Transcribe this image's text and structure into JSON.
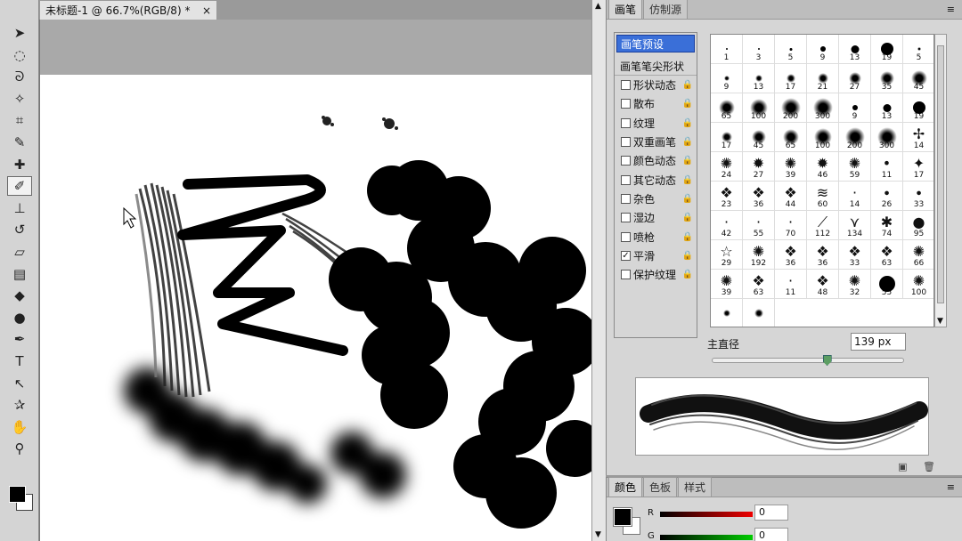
{
  "document": {
    "tab_title": "未标题-1 @ 66.7%(RGB/8) *",
    "close_glyph": "×"
  },
  "brush_panel": {
    "tabs": [
      "画笔",
      "仿制源"
    ],
    "presets_label": "画笔预设",
    "tip_shape_label": "画笔笔尖形状",
    "options": [
      {
        "label": "形状动态",
        "checked": false
      },
      {
        "label": "散布",
        "checked": false
      },
      {
        "label": "纹理",
        "checked": false
      },
      {
        "label": "双重画笔",
        "checked": false
      },
      {
        "label": "颜色动态",
        "checked": false
      },
      {
        "label": "其它动态",
        "checked": false
      },
      {
        "label": "杂色",
        "checked": false
      },
      {
        "label": "湿边",
        "checked": false
      },
      {
        "label": "喷枪",
        "checked": false
      },
      {
        "label": "平滑",
        "checked": true
      },
      {
        "label": "保护纹理",
        "checked": false
      }
    ],
    "brush_tips": [
      {
        "size": "1",
        "kind": "hard",
        "d": 2
      },
      {
        "size": "3",
        "kind": "hard",
        "d": 2
      },
      {
        "size": "5",
        "kind": "hard",
        "d": 3
      },
      {
        "size": "9",
        "kind": "hard",
        "d": 6
      },
      {
        "size": "13",
        "kind": "hard",
        "d": 9
      },
      {
        "size": "19",
        "kind": "hard",
        "d": 14
      },
      {
        "size": "5",
        "kind": "soft",
        "d": 4
      },
      {
        "size": "9",
        "kind": "soft",
        "d": 6
      },
      {
        "size": "13",
        "kind": "soft",
        "d": 8
      },
      {
        "size": "17",
        "kind": "soft",
        "d": 10
      },
      {
        "size": "21",
        "kind": "soft",
        "d": 12
      },
      {
        "size": "27",
        "kind": "soft",
        "d": 14
      },
      {
        "size": "35",
        "kind": "soft",
        "d": 16
      },
      {
        "size": "45",
        "kind": "soft",
        "d": 18
      },
      {
        "size": "65",
        "kind": "soft",
        "d": 18
      },
      {
        "size": "100",
        "kind": "soft",
        "d": 20
      },
      {
        "size": "200",
        "kind": "soft",
        "d": 22
      },
      {
        "size": "300",
        "kind": "soft",
        "d": 22
      },
      {
        "size": "9",
        "kind": "hard",
        "d": 6
      },
      {
        "size": "13",
        "kind": "hard",
        "d": 9
      },
      {
        "size": "19",
        "kind": "hard",
        "d": 14
      },
      {
        "size": "17",
        "kind": "soft",
        "d": 12
      },
      {
        "size": "45",
        "kind": "soft",
        "d": 16
      },
      {
        "size": "65",
        "kind": "soft",
        "d": 18
      },
      {
        "size": "100",
        "kind": "soft",
        "d": 20
      },
      {
        "size": "200",
        "kind": "soft",
        "d": 22
      },
      {
        "size": "300",
        "kind": "soft",
        "d": 22
      },
      {
        "size": "14",
        "kind": "shape",
        "g": "✢"
      },
      {
        "size": "24",
        "kind": "shape",
        "g": "✺"
      },
      {
        "size": "27",
        "kind": "shape",
        "g": "✹"
      },
      {
        "size": "39",
        "kind": "shape",
        "g": "✺"
      },
      {
        "size": "46",
        "kind": "shape",
        "g": "✹"
      },
      {
        "size": "59",
        "kind": "shape",
        "g": "✺"
      },
      {
        "size": "11",
        "kind": "shape",
        "g": "•"
      },
      {
        "size": "17",
        "kind": "shape",
        "g": "✦"
      },
      {
        "size": "23",
        "kind": "shape",
        "g": "❖"
      },
      {
        "size": "36",
        "kind": "shape",
        "g": "❖"
      },
      {
        "size": "44",
        "kind": "shape",
        "g": "❖"
      },
      {
        "size": "60",
        "kind": "shape",
        "g": "≋"
      },
      {
        "size": "14",
        "kind": "shape",
        "g": "·"
      },
      {
        "size": "26",
        "kind": "shape",
        "g": "∙"
      },
      {
        "size": "33",
        "kind": "shape",
        "g": "∙"
      },
      {
        "size": "42",
        "kind": "shape",
        "g": "·"
      },
      {
        "size": "55",
        "kind": "shape",
        "g": "·"
      },
      {
        "size": "70",
        "kind": "shape",
        "g": "·"
      },
      {
        "size": "112",
        "kind": "shape",
        "g": "⟋"
      },
      {
        "size": "134",
        "kind": "shape",
        "g": "⋎"
      },
      {
        "size": "74",
        "kind": "shape",
        "g": "✱"
      },
      {
        "size": "95",
        "kind": "shape",
        "g": "●"
      },
      {
        "size": "29",
        "kind": "shape",
        "g": "☆"
      },
      {
        "size": "192",
        "kind": "shape",
        "g": "✺"
      },
      {
        "size": "36",
        "kind": "shape",
        "g": "❖"
      },
      {
        "size": "36",
        "kind": "shape",
        "g": "❖"
      },
      {
        "size": "33",
        "kind": "shape",
        "g": "❖"
      },
      {
        "size": "63",
        "kind": "shape",
        "g": "❖"
      },
      {
        "size": "66",
        "kind": "shape",
        "g": "✺"
      },
      {
        "size": "39",
        "kind": "shape",
        "g": "✺"
      },
      {
        "size": "63",
        "kind": "shape",
        "g": "❖"
      },
      {
        "size": "11",
        "kind": "shape",
        "g": "·"
      },
      {
        "size": "48",
        "kind": "shape",
        "g": "❖"
      },
      {
        "size": "32",
        "kind": "shape",
        "g": "✺"
      },
      {
        "size": "55",
        "kind": "hard",
        "d": 18
      },
      {
        "size": "100",
        "kind": "shape",
        "g": "✺"
      },
      {
        "size": "",
        "kind": "soft",
        "d": 8
      },
      {
        "size": "",
        "kind": "soft",
        "d": 10
      }
    ],
    "diameter_label": "主直径",
    "diameter_value": "139 px",
    "diameter_level": 0.6
  },
  "color_panel": {
    "tabs": [
      "颜色",
      "色板",
      "样式"
    ],
    "channels": [
      {
        "label": "R",
        "value": "0"
      },
      {
        "label": "G",
        "value": "0"
      }
    ]
  },
  "tools": [
    {
      "name": "move-tool-icon",
      "glyph": "➤"
    },
    {
      "name": "marquee-tool-icon",
      "glyph": "◌"
    },
    {
      "name": "lasso-tool-icon",
      "glyph": "ᘐ"
    },
    {
      "name": "magic-wand-tool-icon",
      "glyph": "✧"
    },
    {
      "name": "crop-tool-icon",
      "glyph": "⌗"
    },
    {
      "name": "eyedropper-tool-icon",
      "glyph": "✎"
    },
    {
      "name": "healing-brush-tool-icon",
      "glyph": "✚"
    },
    {
      "name": "brush-tool-icon",
      "glyph": "✐"
    },
    {
      "name": "clone-stamp-tool-icon",
      "glyph": "⊥"
    },
    {
      "name": "history-brush-tool-icon",
      "glyph": "↺"
    },
    {
      "name": "eraser-tool-icon",
      "glyph": "▱"
    },
    {
      "name": "gradient-tool-icon",
      "glyph": "▤"
    },
    {
      "name": "blur-tool-icon",
      "glyph": "◆"
    },
    {
      "name": "dodge-tool-icon",
      "glyph": "●"
    },
    {
      "name": "pen-tool-icon",
      "glyph": "✒"
    },
    {
      "name": "type-tool-icon",
      "glyph": "T"
    },
    {
      "name": "path-selection-tool-icon",
      "glyph": "↖"
    },
    {
      "name": "custom-shape-tool-icon",
      "glyph": "✰"
    },
    {
      "name": "hand-tool-icon",
      "glyph": "✋"
    },
    {
      "name": "zoom-tool-icon",
      "glyph": "⚲"
    }
  ]
}
